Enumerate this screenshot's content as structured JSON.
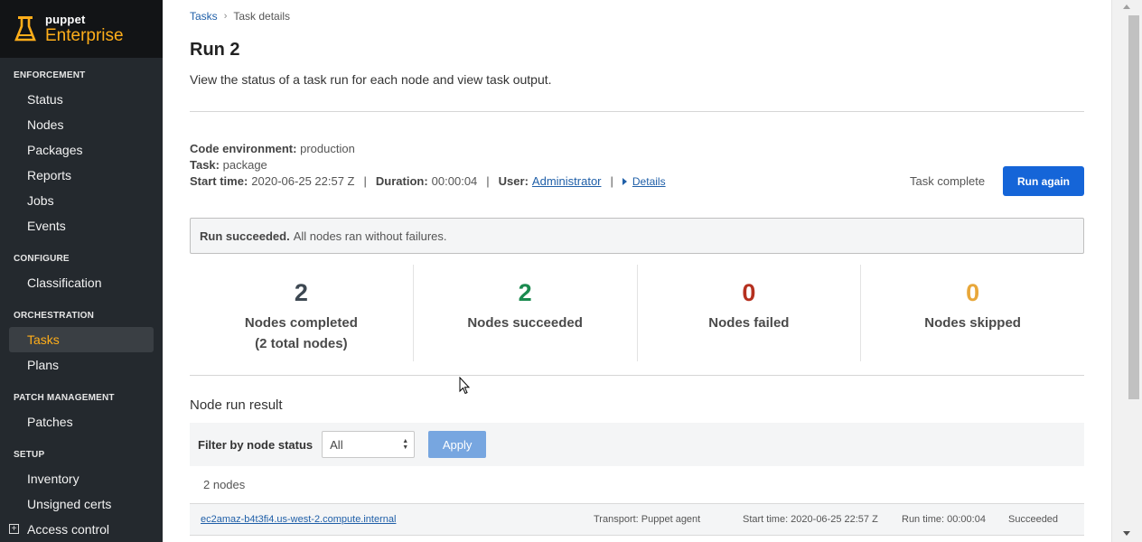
{
  "brand": {
    "small": "puppet",
    "big": "Enterprise"
  },
  "sidebar": {
    "sections": [
      {
        "title": "ENFORCEMENT",
        "items": [
          {
            "label": "Status"
          },
          {
            "label": "Nodes"
          },
          {
            "label": "Packages"
          },
          {
            "label": "Reports"
          },
          {
            "label": "Jobs"
          },
          {
            "label": "Events"
          }
        ]
      },
      {
        "title": "CONFIGURE",
        "items": [
          {
            "label": "Classification"
          }
        ]
      },
      {
        "title": "ORCHESTRATION",
        "items": [
          {
            "label": "Tasks",
            "active": true
          },
          {
            "label": "Plans"
          }
        ]
      },
      {
        "title": "PATCH MANAGEMENT",
        "items": [
          {
            "label": "Patches"
          }
        ]
      },
      {
        "title": "SETUP",
        "items": [
          {
            "label": "Inventory"
          },
          {
            "label": "Unsigned certs"
          },
          {
            "label": "Access control"
          }
        ]
      }
    ]
  },
  "breadcrumb": {
    "root": "Tasks",
    "current": "Task details"
  },
  "page": {
    "title": "Run 2",
    "description": "View the status of a task run for each node and view task output."
  },
  "meta": {
    "code_env_label": "Code environment:",
    "code_env": "production",
    "task_label": "Task:",
    "task": "package",
    "start_label": "Start time:",
    "start": "2020-06-25 22:57 Z",
    "duration_label": "Duration:",
    "duration": "00:00:04",
    "user_label": "User:",
    "user": "Administrator",
    "details": "Details"
  },
  "status": {
    "text": "Task complete",
    "run_again": "Run again"
  },
  "banner": {
    "bold": "Run succeeded.",
    "text": "All nodes ran without failures."
  },
  "stats": [
    {
      "value": "2",
      "label_line1": "Nodes completed",
      "label_line2": "(2 total nodes)",
      "color": "#3d4852"
    },
    {
      "value": "2",
      "label_line1": "Nodes succeeded",
      "label_line2": "",
      "color": "#1b8a4f"
    },
    {
      "value": "0",
      "label_line1": "Nodes failed",
      "label_line2": "",
      "color": "#b5301f"
    },
    {
      "value": "0",
      "label_line1": "Nodes skipped",
      "label_line2": "",
      "color": "#e8a73a"
    }
  ],
  "results": {
    "title": "Node run result",
    "filter_label": "Filter by node status",
    "filter_value": "All",
    "apply": "Apply",
    "count": "2 nodes",
    "rows": [
      {
        "node": "ec2amaz-b4t3fi4.us-west-2.compute.internal",
        "transport": "Transport: Puppet agent",
        "start": "Start time: 2020-06-25 22:57 Z",
        "run_time": "Run time: 00:00:04",
        "status": "Succeeded"
      }
    ]
  }
}
